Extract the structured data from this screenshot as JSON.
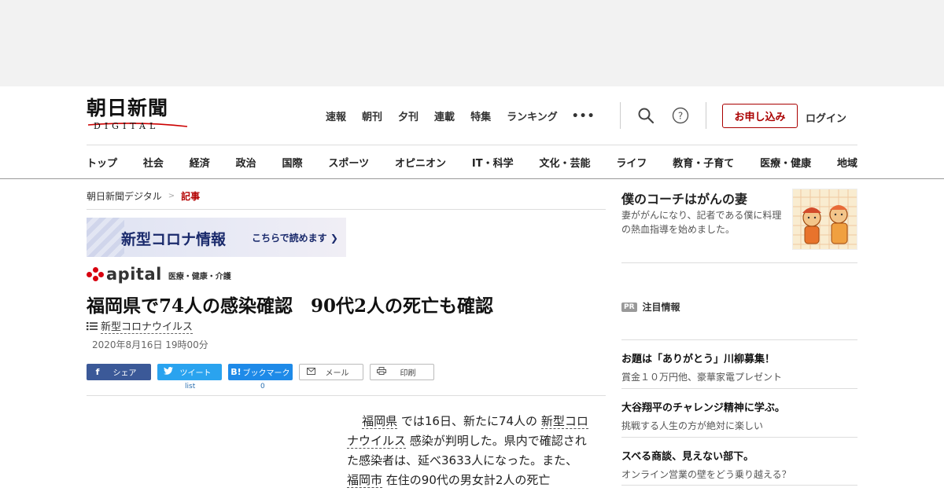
{
  "header": {
    "logo_main": "朝日新聞",
    "logo_sub": "DIGITAL",
    "topnav": [
      "速報",
      "朝刊",
      "夕刊",
      "連載",
      "特集",
      "ランキング"
    ],
    "more_label": "•••",
    "apply_label": "お申し込み",
    "login_label": "ログイン"
  },
  "categories": [
    "トップ",
    "社会",
    "経済",
    "政治",
    "国際",
    "スポーツ",
    "オピニオン",
    "IT・科学",
    "文化・芸能",
    "ライフ",
    "教育・子育て",
    "医療・健康",
    "地域"
  ],
  "breadcrumb": {
    "home": "朝日新聞デジタル",
    "separator": ">",
    "current": "記事"
  },
  "corona_banner": {
    "title": "新型コロナ情報",
    "link": "こちらで読めます ❯"
  },
  "apital": {
    "brand": "apital",
    "category": "医療・健康・介護"
  },
  "article": {
    "headline": "福岡県で74人の感染確認　90代2人の死亡も確認",
    "topic": "新型コロナウイルス",
    "date": "2020年8月16日 19時00分",
    "body": {
      "p1_link1": "福岡県",
      "p1_t1": " では16日、新たに74人の ",
      "p1_link2": "新型コロナウイルス",
      "p1_t2": " 感染が判明した。県内で確認された感染者は、延べ3633人になった。また、 ",
      "p1_link3": "福岡市",
      "p1_t3": " 在住の90代の男女計2人の死亡"
    }
  },
  "share": {
    "facebook": "シェア",
    "twitter": "ツイート",
    "hatena": "ブックマーク",
    "mail": "メール",
    "print": "印刷",
    "twitter_count": "list",
    "hatena_count": "0"
  },
  "sidebar": {
    "promo_title": "僕のコーチはがんの妻",
    "promo_text": "妻ががんになり、記者である僕に料理の熱血指導を始めました。",
    "pr_badge": "PR",
    "pr_label": "注目情報",
    "pr_items": [
      {
        "title": "お題は「ありがとう」川柳募集！",
        "sub": "賞金１０万円他、豪華家電プレゼント"
      },
      {
        "title": "大谷翔平のチャレンジ精神に学ぶ。",
        "sub": "挑戦する人生の方が絶対に楽しい"
      },
      {
        "title": "スベる商談、見えない部下。",
        "sub": "オンライン営業の壁をどう乗り越える？"
      }
    ]
  },
  "colors": {
    "accent_red": "#b30000",
    "facebook": "#3b5998",
    "twitter": "#2aa3ef",
    "hatena": "#1e8ae8"
  }
}
